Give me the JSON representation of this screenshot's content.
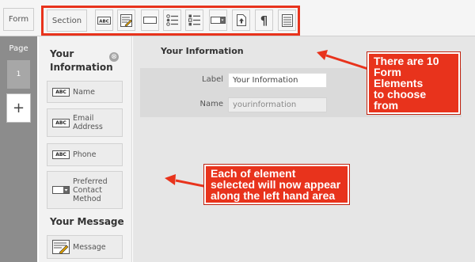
{
  "toolbar": {
    "form_label": "Form",
    "section_label": "Section",
    "elements": [
      {
        "icon": "text-field-icon"
      },
      {
        "icon": "paragraph-text-icon"
      },
      {
        "icon": "single-line-icon"
      },
      {
        "icon": "radio-list-icon"
      },
      {
        "icon": "checkbox-list-icon"
      },
      {
        "icon": "dropdown-icon"
      },
      {
        "icon": "file-upload-icon"
      },
      {
        "icon": "rich-text-icon"
      },
      {
        "icon": "divider-lines-icon"
      }
    ],
    "highlight_color": "#e8331c"
  },
  "pages": {
    "label": "Page",
    "current": "1",
    "add_symbol": "+"
  },
  "sidebar": {
    "section1_title": "Your Information",
    "collapse_symbol": "⊗",
    "items1": [
      {
        "label": "Name",
        "icon": "text-field-icon",
        "icon_text": "ABC"
      },
      {
        "label": "Email Address",
        "icon": "text-field-icon",
        "icon_text": "ABC"
      },
      {
        "label": "Phone",
        "icon": "text-field-icon",
        "icon_text": "ABC"
      },
      {
        "label": "Preferred Contact Method",
        "icon": "dropdown-icon"
      }
    ],
    "section2_title": "Your Message",
    "items2": [
      {
        "label": "Message",
        "icon": "paragraph-text-icon"
      }
    ]
  },
  "main": {
    "section_title": "Your Information",
    "label_caption": "Label",
    "label_value": "Your Information",
    "name_caption": "Name",
    "name_value": "yourinformation"
  },
  "callouts": {
    "top": "There are 10\nForm Elements\nto choose from",
    "bottom": "Each of element\nselected will now appear\nalong the left hand area",
    "color": "#e8331c"
  }
}
